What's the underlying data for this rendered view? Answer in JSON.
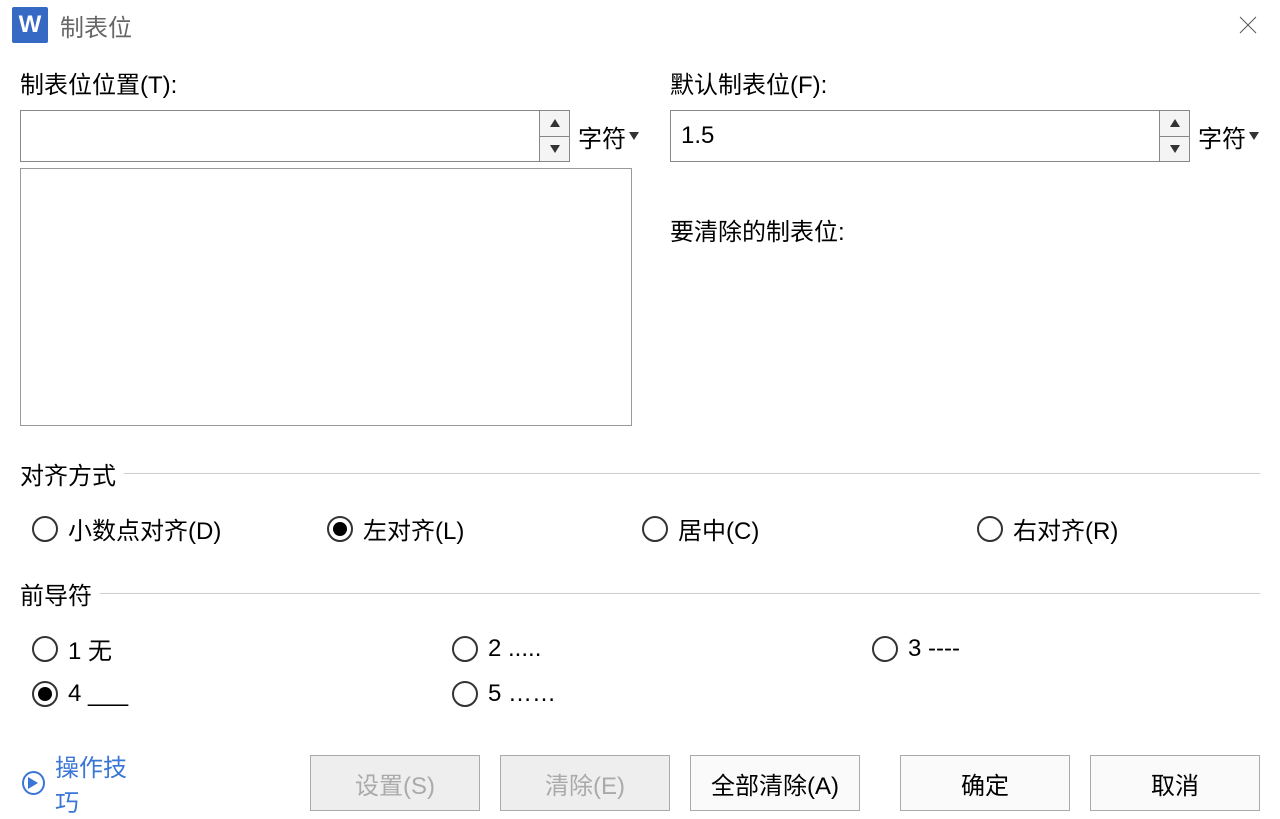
{
  "titlebar": {
    "app_letter": "W",
    "title": "制表位"
  },
  "fields": {
    "tab_position_label": "制表位位置(T):",
    "tab_position_value": "",
    "default_tab_label": "默认制表位(F):",
    "default_tab_value": "1.5",
    "unit_suffix": "字符",
    "to_clear_label": "要清除的制表位:"
  },
  "alignment": {
    "group_title": "对齐方式",
    "options": {
      "decimal": "小数点对齐(D)",
      "left": "左对齐(L)",
      "center": "居中(C)",
      "right": "右对齐(R)"
    },
    "selected": "left"
  },
  "leader": {
    "group_title": "前导符",
    "options": {
      "opt1": "1 无",
      "opt2": "2 .....",
      "opt3": "3 ----",
      "opt4": "4 ___",
      "opt5": "5 ……"
    },
    "selected": "opt4"
  },
  "buttons": {
    "tips": "操作技巧",
    "set": "设置(S)",
    "clear": "清除(E)",
    "clear_all": "全部清除(A)",
    "ok": "确定",
    "cancel": "取消"
  }
}
